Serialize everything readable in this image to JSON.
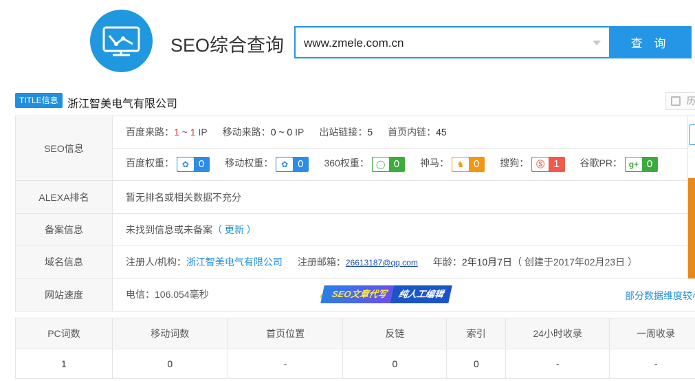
{
  "header": {
    "logo_icon": "chart-monitor-icon",
    "title": "SEO综合查询",
    "search_value": "www.zmele.com.cn",
    "search_button": "查 询"
  },
  "title_info": {
    "badge": "TITLE信息",
    "text": "浙江智美电气有限公司",
    "history_label": "历"
  },
  "seo": {
    "label": "SEO信息",
    "baidu_traffic_label": "百度来路：",
    "baidu_traffic_from": "1",
    "baidu_traffic_sep": " ~ ",
    "baidu_traffic_to": "1",
    "baidu_traffic_unit": " IP",
    "mobile_traffic_label": "移动来路：",
    "mobile_traffic_value": "0 ~ 0",
    "mobile_traffic_unit": " IP",
    "outlinks_label": "出站链接：",
    "outlinks_value": "5",
    "homepage_links_label": "首页内链：",
    "homepage_links_value": "45",
    "baidu_weight_label": "百度权重：",
    "baidu_weight_value": "0",
    "mobile_weight_label": "移动权重：",
    "mobile_weight_value": "0",
    "w360_label": "360权重：",
    "w360_value": "0",
    "shenma_label": "神马：",
    "shenma_value": "0",
    "sogou_label": "搜狗：",
    "sogou_value": "1",
    "google_label": "谷歌PR：",
    "google_value": "0"
  },
  "alexa": {
    "label": "ALEXA排名",
    "text": "暂无排名或相关数据不充分"
  },
  "beian": {
    "label": "备案信息",
    "text": "未找到信息或未备案",
    "update_link": "（ 更新 ）"
  },
  "domain": {
    "label": "域名信息",
    "registrant_label": "注册人/机构：",
    "registrant_value": "浙江智美电气有限公司",
    "email_label": "注册邮箱：",
    "email_value": "26613187@qq.com",
    "age_label": "年龄：",
    "age_value": "2年10月7日",
    "created": "（ 创建于2017年02月23日 ）"
  },
  "speed": {
    "label": "网站速度",
    "text": "电信：106.054毫秒",
    "ad_part1": "SEO文章代写",
    "ad_part2": "纯人工编辑",
    "partial_note": "部分数据维度较小"
  },
  "stats": {
    "headers": [
      "PC词数",
      "移动词数",
      "首页位置",
      "反链",
      "索引",
      "24小时收录",
      "一周收录"
    ],
    "values": [
      "1",
      "0",
      "-",
      "0",
      "0",
      "-",
      "-"
    ]
  }
}
